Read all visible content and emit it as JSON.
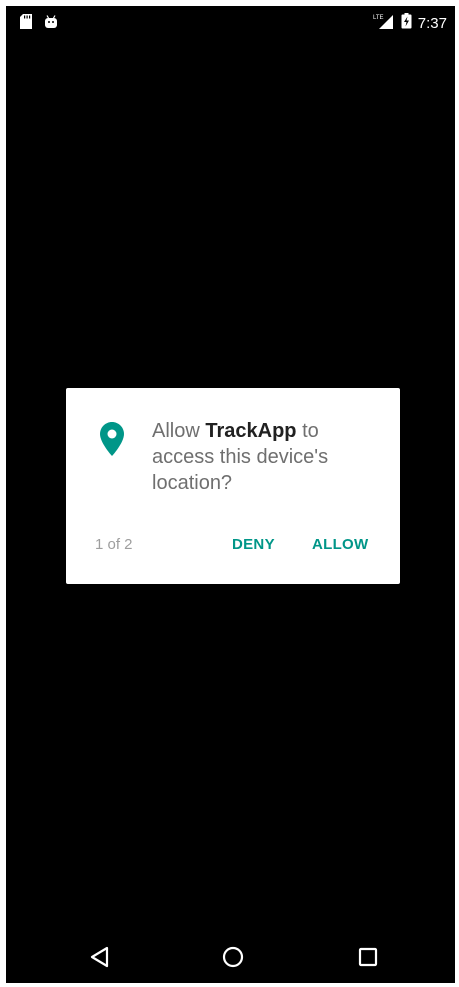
{
  "status_bar": {
    "time": "7:37",
    "network": "LTE",
    "icons": [
      "sd-card-icon",
      "android-icon",
      "lte-signal-icon",
      "battery-charging-icon"
    ]
  },
  "dialog": {
    "message_prefix": "Allow ",
    "app_name": "TrackApp",
    "message_suffix": " to access this device's location?",
    "counter": "1 of 2",
    "deny_label": "DENY",
    "allow_label": "ALLOW",
    "icon": "location-pin-icon",
    "accent_color": "#009688"
  },
  "nav_bar": {
    "icons": [
      "back-icon",
      "home-icon",
      "recents-icon"
    ]
  }
}
